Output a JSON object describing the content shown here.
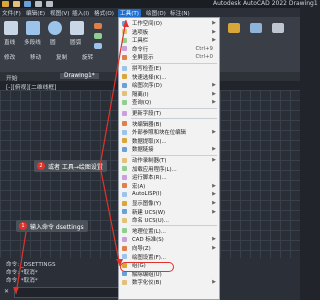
{
  "window": {
    "title": "Autodesk AutoCAD 2022   Drawing1",
    "quick_access_icons": [
      "new-icon",
      "open-icon",
      "save-icon",
      "undo-icon",
      "redo-icon"
    ]
  },
  "menubar": {
    "items": [
      {
        "label": "文件(F)",
        "name": "menu-file"
      },
      {
        "label": "编辑(E)",
        "name": "menu-edit"
      },
      {
        "label": "视图(V)",
        "name": "menu-view"
      },
      {
        "label": "插入(I)",
        "name": "menu-insert"
      },
      {
        "label": "格式(O)",
        "name": "menu-format"
      },
      {
        "label": "工具(T)",
        "name": "menu-tools"
      },
      {
        "label": "绘图(D)",
        "name": "menu-draw"
      },
      {
        "label": "标注(N)",
        "name": "menu-dimension"
      }
    ]
  },
  "ribbon": {
    "labels": [
      "直线",
      "多段线",
      "圆",
      "圆弧"
    ],
    "row_labels": [
      "修改",
      "移动",
      "复制",
      "旋转"
    ]
  },
  "doc_tabs": {
    "start": "开始",
    "drawing": "Drawing1*"
  },
  "viewport_label": "[-][俯视][二维线框]",
  "tools_menu": {
    "items": [
      {
        "label": "工作空间(O)",
        "arrow": true
      },
      {
        "label": "选项板",
        "arrow": true
      },
      {
        "label": "工具栏",
        "arrow": true
      },
      {
        "label": "命令行",
        "shortcut": "Ctrl+9"
      },
      {
        "label": "全屏显示",
        "shortcut": "Ctrl+0"
      },
      {
        "label": "拼写检查(E)"
      },
      {
        "label": "快速选择(K)..."
      },
      {
        "label": "绘图次序(D)",
        "arrow": true
      },
      {
        "label": "隔离(I)",
        "arrow": true
      },
      {
        "label": "查询(Q)",
        "arrow": true
      },
      {
        "label": "更新字段(T)"
      },
      {
        "label": "块编辑器(B)"
      },
      {
        "label": "外部参照和块在位编辑",
        "arrow": true
      },
      {
        "label": "数据提取(X)..."
      },
      {
        "label": "数据链接",
        "arrow": true
      },
      {
        "label": "动作录制器(T)",
        "arrow": true
      },
      {
        "label": "加载应用程序(L)..."
      },
      {
        "label": "运行脚本(R)..."
      },
      {
        "label": "宏(A)",
        "arrow": true
      },
      {
        "label": "AutoLISP(I)",
        "arrow": true
      },
      {
        "label": "显示图像(Y)",
        "arrow": true
      },
      {
        "label": "新建 UCS(W)",
        "arrow": true
      },
      {
        "label": "命名 UCS(U)..."
      },
      {
        "label": "地理位置(L)..."
      },
      {
        "label": "CAD 标准(S)",
        "arrow": true
      },
      {
        "label": "向导(Z)",
        "arrow": true
      },
      {
        "label": "绘图设置(F)..."
      },
      {
        "label": "组(G)"
      },
      {
        "label": "解除编组(U)"
      },
      {
        "label": "数字化仪(B)",
        "arrow": true
      }
    ]
  },
  "callouts": {
    "step1": {
      "num": "1",
      "text": "输入命令 dsettings"
    },
    "step2": {
      "num": "2",
      "text": "或者 工具→绘图设置"
    }
  },
  "command_line": {
    "line1": "命令: _DSETTINGS",
    "line2": "命令: *取消*",
    "line3": "命令: *取消*"
  },
  "colors": {
    "accent": "#1f6fd1",
    "callout_number": "#e0322a"
  }
}
